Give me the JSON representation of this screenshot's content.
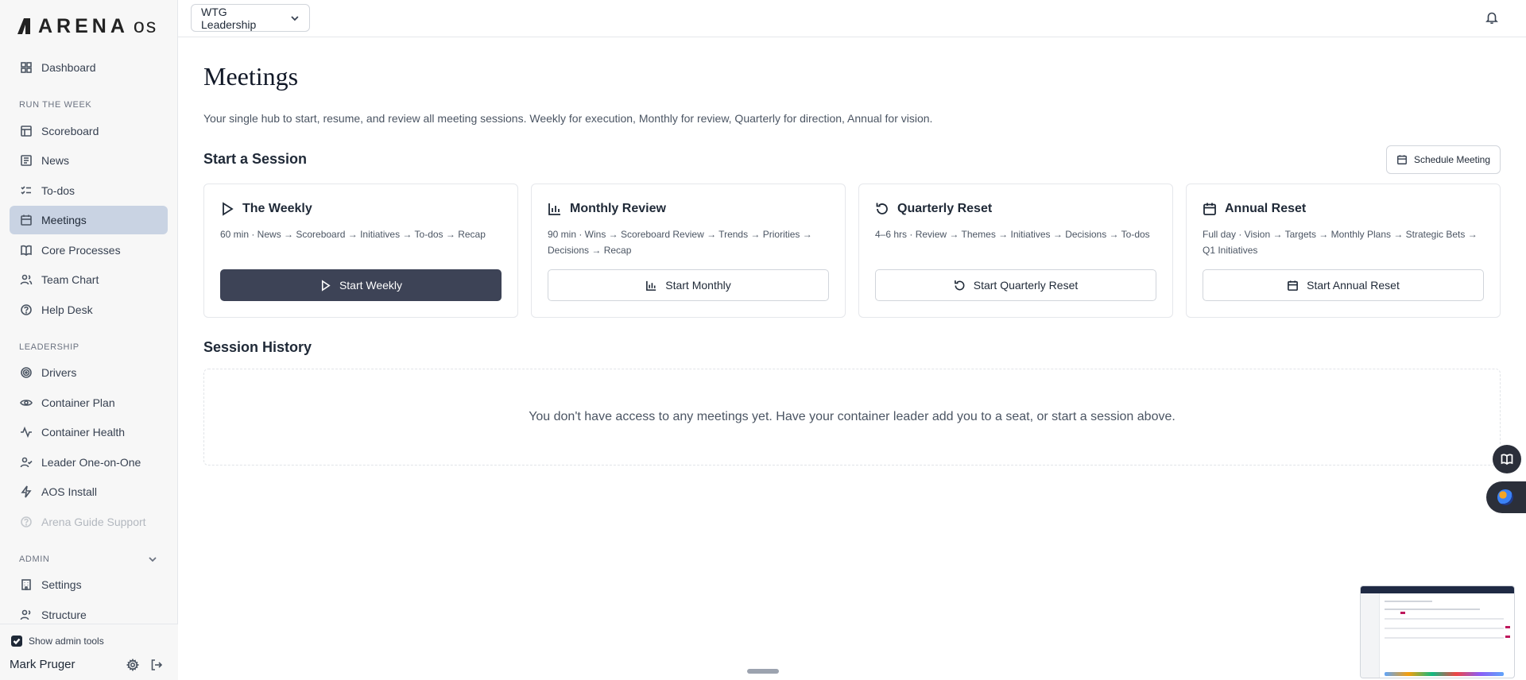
{
  "app": {
    "logo_text": "ARENA",
    "logo_suffix": "os"
  },
  "sidebar": {
    "dashboard": "Dashboard",
    "section_run": "RUN THE WEEK",
    "run_items": [
      "Scoreboard",
      "News",
      "To-dos",
      "Meetings",
      "Core Processes",
      "Team Chart",
      "Help Desk"
    ],
    "section_leadership": "LEADERSHIP",
    "leadership_items": [
      "Drivers",
      "Container Plan",
      "Container Health",
      "Leader One-on-One",
      "AOS Install",
      "Arena Guide Support"
    ],
    "section_admin": "ADMIN",
    "admin_items": [
      "Settings",
      "Structure"
    ],
    "active_item": "Meetings",
    "show_admin_tools_label": "Show admin tools",
    "show_admin_tools_checked": true,
    "user_name": "Mark Pruger"
  },
  "topbar": {
    "team_selector": "WTG Leadership"
  },
  "main": {
    "title": "Meetings",
    "subtitle": "Your single hub to start, resume, and review all meeting sessions. Weekly for execution, Monthly for review, Quarterly for direction, Annual for vision.",
    "start_section_title": "Start a Session",
    "schedule_button": "Schedule Meeting",
    "cards": [
      {
        "title": "The Weekly",
        "desc": "60 min · News → Scoreboard → Initiatives → To-dos → Recap",
        "button": "Start Weekly",
        "icon": "play-icon"
      },
      {
        "title": "Monthly Review",
        "desc": "90 min · Wins → Scoreboard Review → Trends → Priorities → Decisions → Recap",
        "button": "Start Monthly",
        "icon": "bar-chart-icon"
      },
      {
        "title": "Quarterly Reset",
        "desc": "4–6 hrs · Review → Themes → Initiatives → Decisions → To-dos",
        "button": "Start Quarterly Reset",
        "icon": "rotate-icon"
      },
      {
        "title": "Annual Reset",
        "desc": "Full day · Vision → Targets → Monthly Plans → Strategic Bets → Q1 Initiatives",
        "button": "Start Annual Reset",
        "icon": "calendar-icon"
      }
    ],
    "history_title": "Session History",
    "history_empty": "You don't have access to any meetings yet. Have your container leader add you to a seat, or start a session above."
  },
  "colors": {
    "primary_button": "#3d4356",
    "active_nav": "#c9d3e3",
    "sidebar_bg": "#f7f7f7"
  }
}
